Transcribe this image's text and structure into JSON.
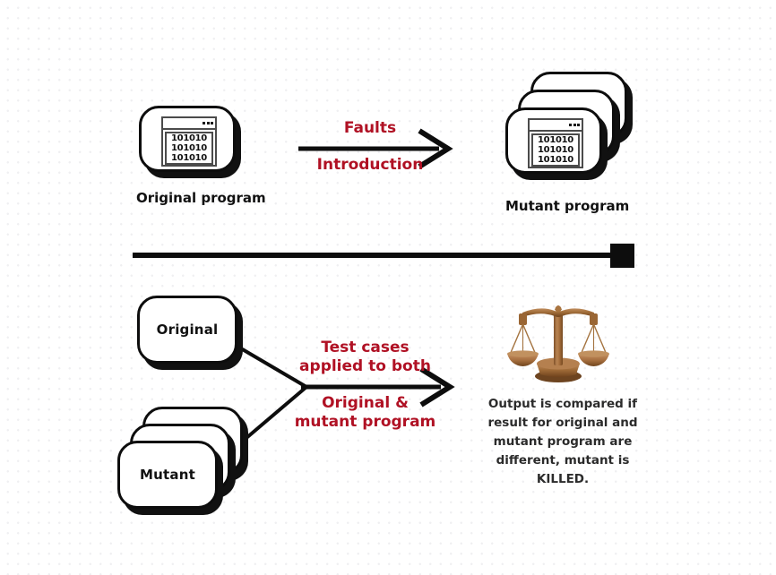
{
  "diagram": {
    "title": "Mutation testing process diagram",
    "background": "#ffffff",
    "dot_grid_color": "#efeff1",
    "accent_color": "#b01124",
    "line_color": "#0d0d0d",
    "scales_color": "#9a6a3c"
  },
  "top_row": {
    "original": {
      "label": "Original program",
      "icon_name": "code-window-icon",
      "code_lines": [
        "101010",
        "101010",
        "101010"
      ]
    },
    "arrow": {
      "icon_name": "right-arrow-icon",
      "label_above": "Faults",
      "label_below": "Introduction"
    },
    "mutant": {
      "label": "Mutant program",
      "icon_name": "code-window-icon",
      "code_lines": [
        "101010",
        "101010",
        "101010"
      ],
      "stack_count": 3
    }
  },
  "divider": {
    "icon_name": "horizontal-divider-line",
    "end_cap": "square"
  },
  "bottom_row": {
    "original": {
      "label": "Original"
    },
    "mutant": {
      "label": "Mutant",
      "stack_count": 3
    },
    "arrow": {
      "icon_name": "right-arrow-icon",
      "label_above_line_1": "Test cases",
      "label_above_line_2": "applied to both",
      "label_below_line_1": "Original &",
      "label_below_line_2": "mutant program"
    },
    "result": {
      "icon_name": "balance-scales-icon",
      "text": "Output is compared if result for original and mutant program are different, mutant is KILLED."
    }
  }
}
